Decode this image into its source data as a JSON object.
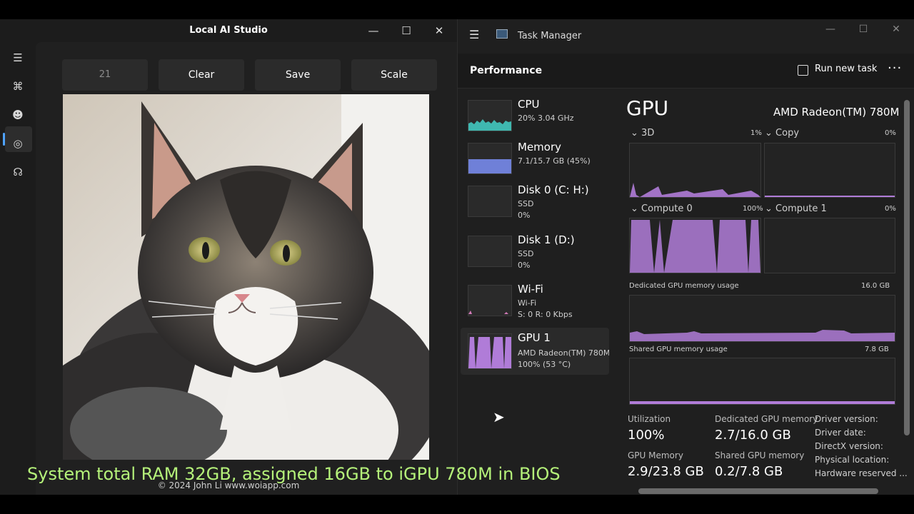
{
  "app": {
    "title": "Local AI Studio",
    "window": {
      "minimize": "—",
      "maximize": "☐",
      "close": "✕"
    },
    "rail": [
      {
        "icon": "hamburger-icon",
        "glyph": "☰"
      },
      {
        "icon": "command-icon",
        "glyph": "⌘"
      },
      {
        "icon": "smiley-icon",
        "glyph": "☻"
      },
      {
        "icon": "chat-icon",
        "glyph": "◎"
      },
      {
        "icon": "voice-icon",
        "glyph": "☊"
      }
    ],
    "toolbar": {
      "seed_value": "21",
      "clear": "Clear",
      "save": "Save",
      "scale": "Scale"
    },
    "footer": "© 2024 John Li www.woiapp.com"
  },
  "taskmanager": {
    "title": "Task Manager",
    "window": {
      "minimize": "—",
      "maximize": "☐",
      "close": "✕"
    },
    "section": "Performance",
    "run_new_task": "Run new task",
    "more": "···",
    "devices": [
      {
        "name": "CPU",
        "line1": "20%  3.04 GHz",
        "line2": ""
      },
      {
        "name": "Memory",
        "line1": "7.1/15.7 GB (45%)",
        "line2": ""
      },
      {
        "name": "Disk 0 (C: H:)",
        "line1": "SSD",
        "line2": "0%"
      },
      {
        "name": "Disk 1 (D:)",
        "line1": "SSD",
        "line2": "0%"
      },
      {
        "name": "Wi-Fi",
        "line1": "Wi-Fi",
        "line2": "S: 0  R: 0 Kbps"
      },
      {
        "name": "GPU 1",
        "line1": "AMD Radeon(TM) 780M",
        "line2": "100%  (53 °C)"
      }
    ],
    "gpu": {
      "title": "GPU",
      "model": "AMD Radeon(TM) 780M",
      "engines": [
        {
          "label": "3D",
          "value": "1%"
        },
        {
          "label": "Copy",
          "value": "0%"
        },
        {
          "label": "Compute 0",
          "value": "100%"
        },
        {
          "label": "Compute 1",
          "value": "0%"
        }
      ],
      "dedicated_label": "Dedicated GPU memory usage",
      "dedicated_max": "16.0 GB",
      "shared_label": "Shared GPU memory usage",
      "shared_max": "7.8 GB",
      "stats": {
        "utilization_label": "Utilization",
        "utilization_value": "100%",
        "dedicated_mem_label": "Dedicated GPU memory",
        "dedicated_mem_value": "2.7/16.0 GB",
        "gpu_mem_label": "GPU Memory",
        "gpu_mem_value": "2.9/23.8 GB",
        "shared_mem_label": "Shared GPU memory",
        "shared_mem_value": "0.2/7.8 GB",
        "driver_version": "Driver version:",
        "driver_date": "Driver date:",
        "directx_version": "DirectX version:",
        "physical_location": "Physical location:",
        "hardware_reserved": "Hardware reserved ..."
      }
    }
  },
  "caption": "System total RAM 32GB, assigned 16GB to iGPU 780M in BIOS",
  "colors": {
    "accent": "#4fa3ff",
    "gpu_graph": "#b07cd8",
    "cpu_graph": "#3fb8b0",
    "mem_graph": "#6f80d8",
    "caption": "#b5f27a"
  }
}
